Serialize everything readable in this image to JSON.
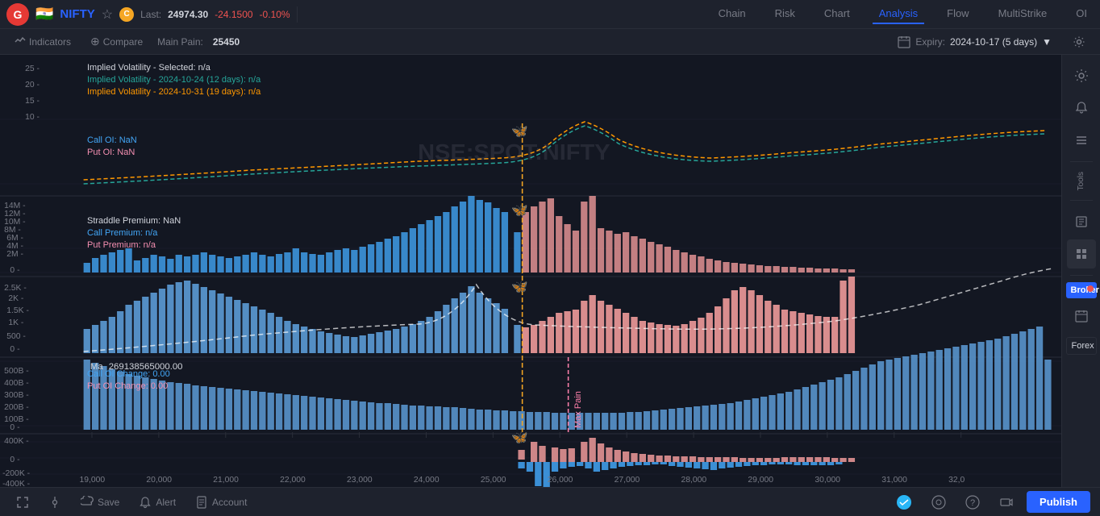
{
  "topbar": {
    "logo": "G",
    "flag": "🇮🇳",
    "symbol": "NIFTY",
    "last_label": "Last:",
    "last_price": "24974.30",
    "price_change": "-24.1500",
    "price_change_pct": "-0.10%",
    "nav": {
      "chain": "Chain",
      "risk": "Risk",
      "chart": "Chart",
      "analysis": "Analysis",
      "flow": "Flow",
      "multistrike": "MultiStrike",
      "oi": "OI"
    }
  },
  "toolbar": {
    "indicators_label": "Indicators",
    "compare_label": "Compare",
    "main_pain_label": "Main Pain:",
    "main_pain_value": "25450",
    "expiry_label": "Expiry:",
    "expiry_value": "2024-10-17 (5 days)"
  },
  "chart": {
    "watermark": "NSE:SPOT:NIFTY",
    "iv_selected": "Implied Volatility - Selected: n/a",
    "iv_oct24": "Implied Volatility - 2024-10-24 (12 days): n/a",
    "iv_oct31": "Implied Volatility - 2024-10-31 (19 days): n/a",
    "call_oi": "Call OI: NaN",
    "put_oi": "Put OI: NaN",
    "straddle_premium": "Straddle Premium: NaN",
    "call_premium": "Call Premium: n/a",
    "put_premium": "Put Premium: n/a",
    "max_pain_label": "Max Pain",
    "max_pain_value": "269138565000.00",
    "call_oi_change": "Call OI Change: 0.00",
    "put_oi_change": "Put OI Change: 0.00",
    "y_axis_iv": [
      "25",
      "20",
      "15",
      "10"
    ],
    "y_axis_oi": [
      "14M",
      "12M",
      "10M",
      "8M",
      "6M",
      "4M",
      "2M",
      "0"
    ],
    "y_axis_premium": [
      "2.5K",
      "2K",
      "1.5K",
      "1K",
      "500",
      "0"
    ],
    "y_axis_max": [
      "500B",
      "400B",
      "300B",
      "200B",
      "100B",
      "0"
    ],
    "y_axis_oichange": [
      "400K",
      "0",
      "-200K",
      "-400K"
    ],
    "x_axis": [
      "19,000",
      "20,000",
      "21,000",
      "22,000",
      "23,000",
      "24,000",
      "25,000",
      "26,000",
      "27,000",
      "28,000",
      "29,000",
      "30,000",
      "31,000",
      "32,0"
    ]
  },
  "right_sidebar": {
    "tools_label": "Tools",
    "broker_label": "Broker",
    "forex_label": "Forex"
  },
  "bottom_bar": {
    "fullscreen_label": "",
    "settings_label": "",
    "save_label": "Save",
    "alert_label": "Alert",
    "account_label": "Account",
    "telegram_label": "",
    "info_label": "",
    "help_label": "",
    "video_label": "",
    "publish_label": "Publish"
  }
}
